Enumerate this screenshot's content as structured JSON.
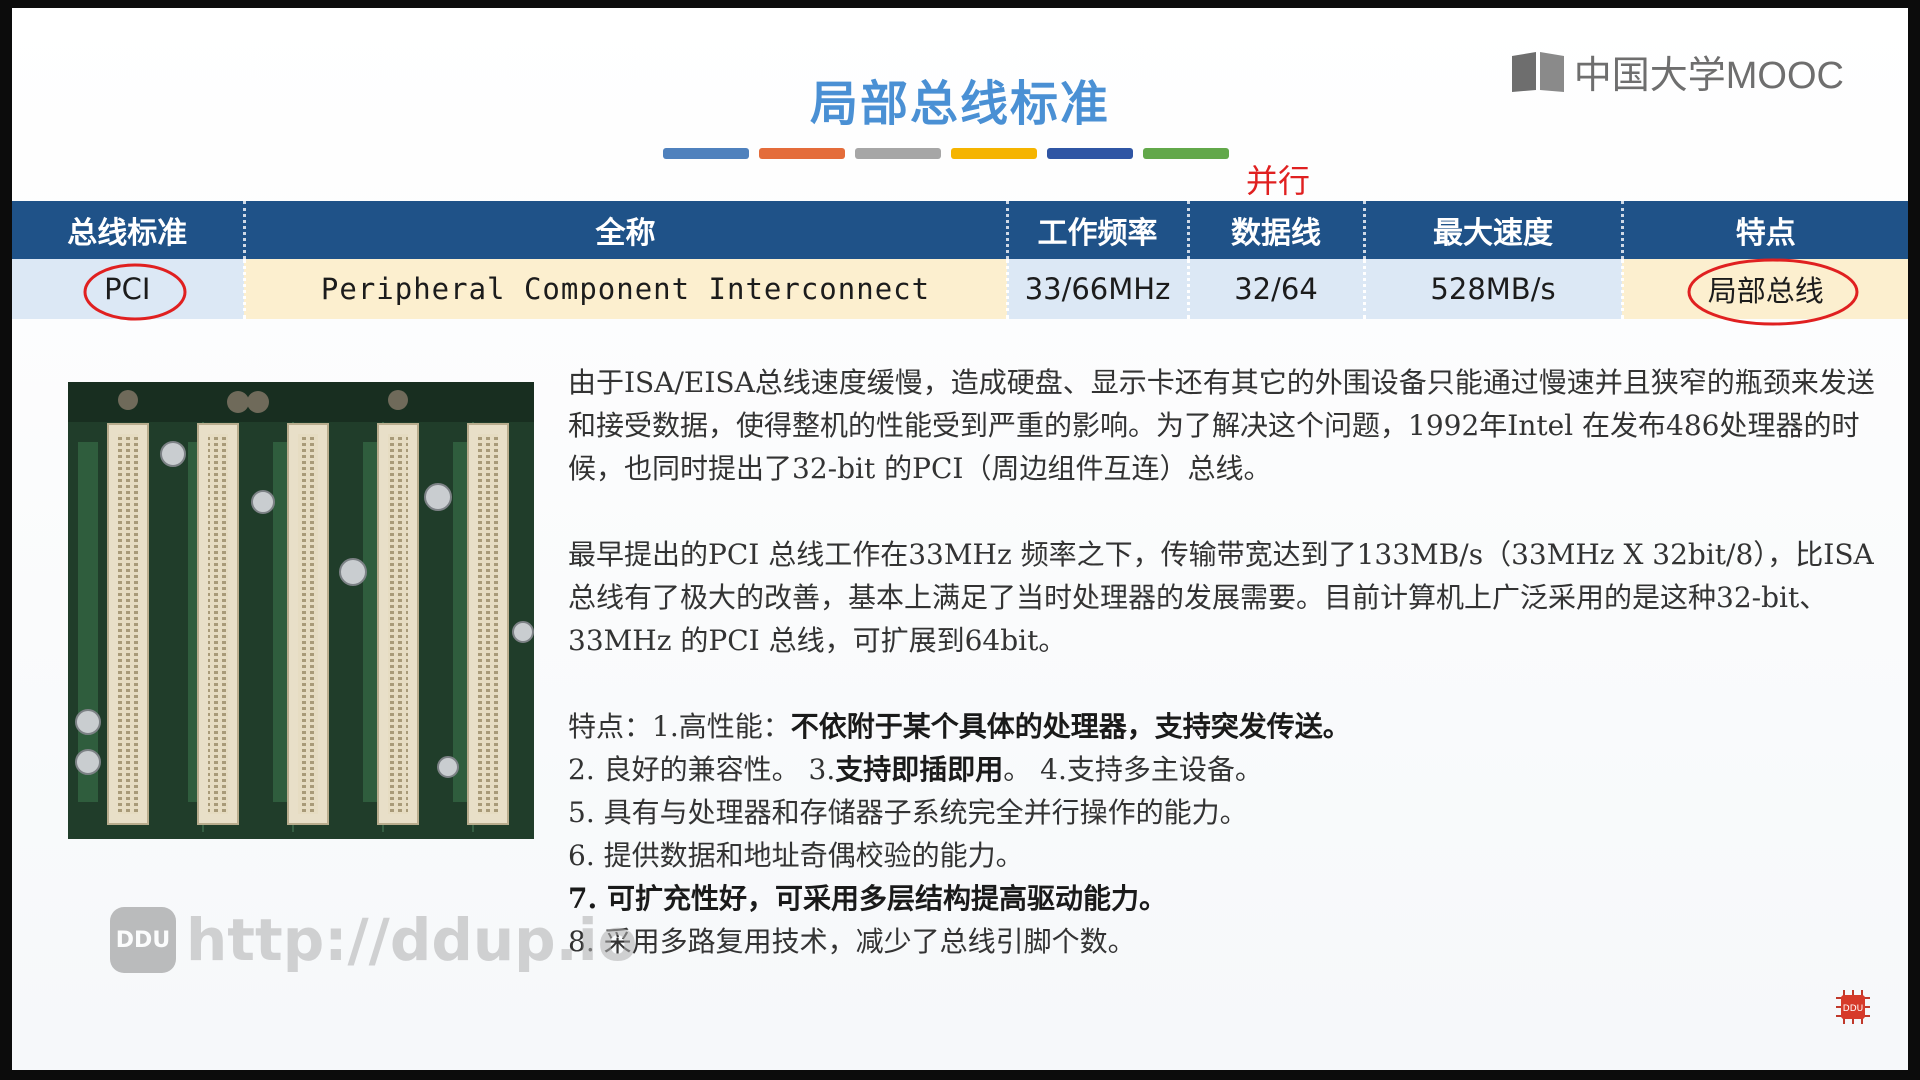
{
  "title": "局部总线标准",
  "logo_text": "中国大学MOOC",
  "color_bar": [
    "#4f81bd",
    "#e46c3a",
    "#a6a6a6",
    "#f5b400",
    "#2f55a4",
    "#62a84a"
  ],
  "annotation_parallel": "并行",
  "table": {
    "headers": [
      "总线标准",
      "全称",
      "工作频率",
      "数据线",
      "最大速度",
      "特点"
    ],
    "row": {
      "standard": "PCI",
      "full_name": "Peripheral Component Interconnect",
      "frequency": "33/66MHz",
      "data_lines": "32/64",
      "max_speed": "528MB/s",
      "feature": "局部总线"
    }
  },
  "paragraph1": "由于ISA/EISA总线速度缓慢，造成硬盘、显示卡还有其它的外围设备只能通过慢速并且狭窄的瓶颈来发送和接受数据，使得整机的性能受到严重的影响。为了解决这个问题，1992年Intel 在发布486处理器的时候，也同时提出了32-bit 的PCI（周边组件互连）总线。",
  "paragraph2": "最早提出的PCI 总线工作在33MHz 频率之下，传输带宽达到了133MB/s（33MHz X 32bit/8），比ISA 总线有了极大的改善，基本上满足了当时处理器的发展需要。目前计算机上广泛采用的是这种32-bit、33MHz 的PCI 总线，可扩展到64bit。",
  "features": {
    "prefix": "特点：1.高性能：",
    "f1_bold": "不依附于某个具体的处理器，支持突发传送。",
    "f2": "2. 良好的兼容性。 3.",
    "f3_bold": "支持即插即用",
    "f3_tail": "。 4.支持多主设备。",
    "f5": "5. 具有与处理器和存储器子系统完全并行操作的能力。",
    "f6": "6. 提供数据和地址奇偶校验的能力。",
    "f7_bold": "7. 可扩充性好，可采用多层结构提高驱动能力。",
    "f8": "8. 采用多路复用技术，减少了总线引脚个数。"
  },
  "watermark": {
    "badge": "DDU",
    "url": "http://ddup.io"
  },
  "corner_badge": "DDU"
}
